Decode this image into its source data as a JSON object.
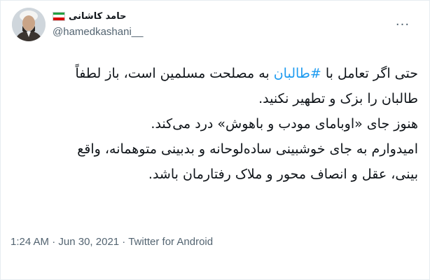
{
  "author": {
    "display_name": "حامد کاشانی",
    "handle": "@hamedkashani__",
    "flag": "iran-flag-icon",
    "avatar": "profile-photo"
  },
  "tweet": {
    "line1_before": "حتی اگر تعامل با ",
    "hashtag": "#طالبان",
    "line1_after": " به مصلحت مسلمین است، باز لطفاً",
    "line2": "طالبان را بزک و تطهیر نکنید.",
    "line3": "هنوز جای «اوبامای مودب و باهوش» درد می‌کند.",
    "line4": "امیدوارم به جای خوشبینی ساده‌لوحانه و بدبینی متوهمانه، واقع",
    "line5": "بینی، عقل و انصاف محور و ملاک رفتارمان باشد."
  },
  "meta": {
    "time": "1:24 AM",
    "separator1": " · ",
    "date": "Jun 30, 2021",
    "separator2": " · ",
    "source": "Twitter for Android"
  },
  "menu": {
    "icon": "more-horizontal-icon",
    "glyph": "···"
  },
  "colors": {
    "hashtag": "#1d9bf0",
    "secondary": "#536471",
    "text": "#0f1419"
  }
}
